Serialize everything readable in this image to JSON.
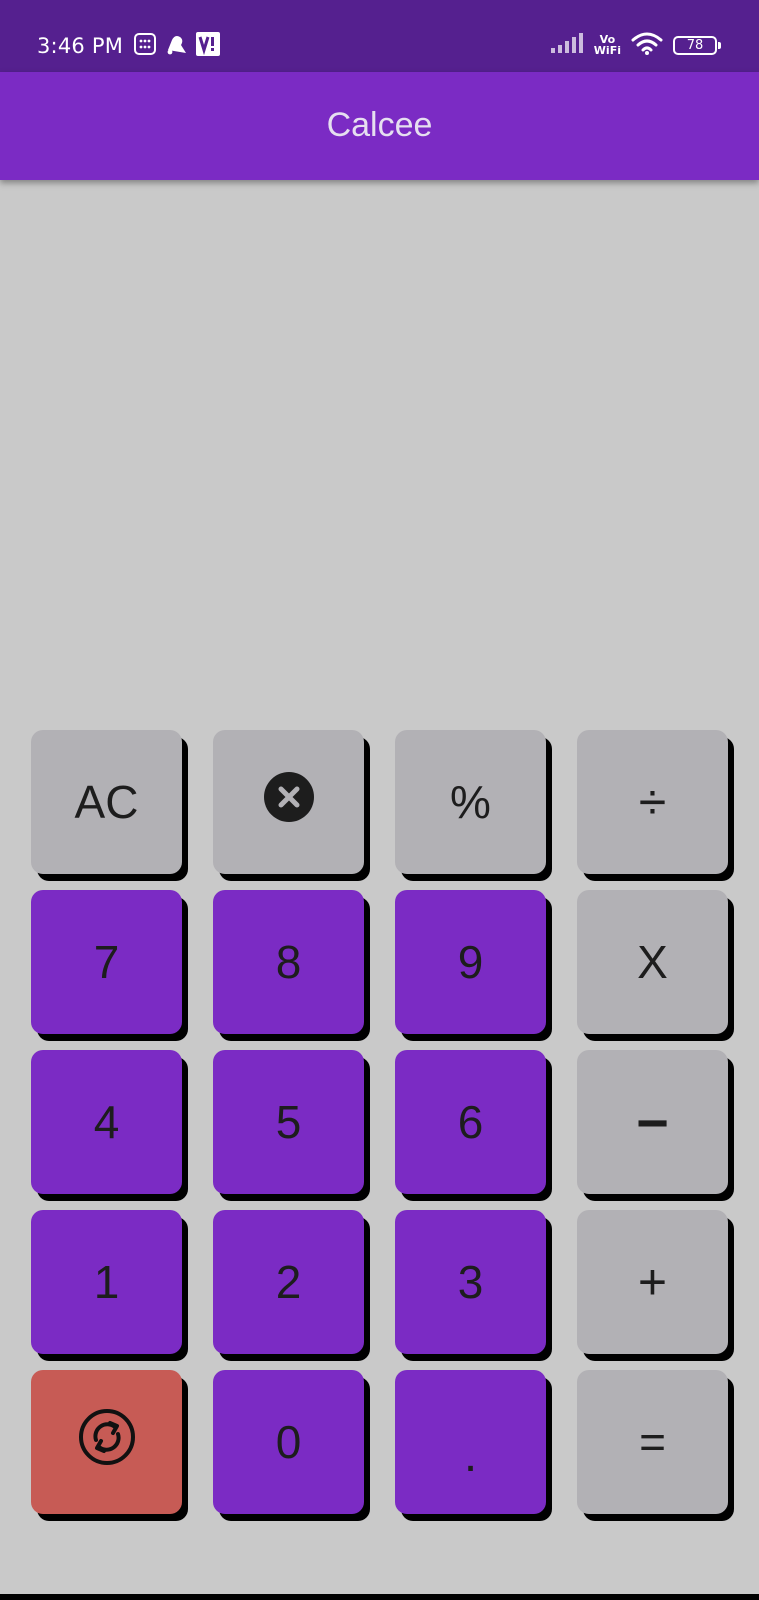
{
  "status_bar": {
    "time": "3:46 PM",
    "vowifi_top": "Vo",
    "vowifi_bottom": "WiFi",
    "battery": "78",
    "icons": [
      "calculator-grid-icon",
      "notification-bell-icon",
      "vi-carrier-icon",
      "signal-bars-icon",
      "wifi-icon",
      "battery-icon"
    ]
  },
  "app_bar": {
    "title": "Calcee"
  },
  "keypad": {
    "rows": [
      [
        {
          "label": "AC",
          "style": "gray"
        },
        {
          "label": "",
          "icon": "backspace-x-icon",
          "style": "gray"
        },
        {
          "label": "%",
          "style": "gray"
        },
        {
          "label": "÷",
          "style": "gray"
        }
      ],
      [
        {
          "label": "7",
          "style": "purple"
        },
        {
          "label": "8",
          "style": "purple"
        },
        {
          "label": "9",
          "style": "purple"
        },
        {
          "label": "X",
          "style": "gray"
        }
      ],
      [
        {
          "label": "4",
          "style": "purple"
        },
        {
          "label": "5",
          "style": "purple"
        },
        {
          "label": "6",
          "style": "purple"
        },
        {
          "label": "−",
          "style": "gray"
        }
      ],
      [
        {
          "label": "1",
          "style": "purple"
        },
        {
          "label": "2",
          "style": "purple"
        },
        {
          "label": "3",
          "style": "purple"
        },
        {
          "label": "+",
          "style": "gray"
        }
      ],
      [
        {
          "label": "",
          "icon": "refresh-cycle-icon",
          "style": "red"
        },
        {
          "label": "0",
          "style": "purple"
        },
        {
          "label": ".",
          "style": "purple"
        },
        {
          "label": "=",
          "style": "gray"
        }
      ]
    ]
  },
  "colors": {
    "status_bar": "#55208f",
    "primary": "#7b2bc4",
    "background": "#c9c9c9",
    "key_gray": "#b2b1b5",
    "key_red": "#c75b55"
  }
}
